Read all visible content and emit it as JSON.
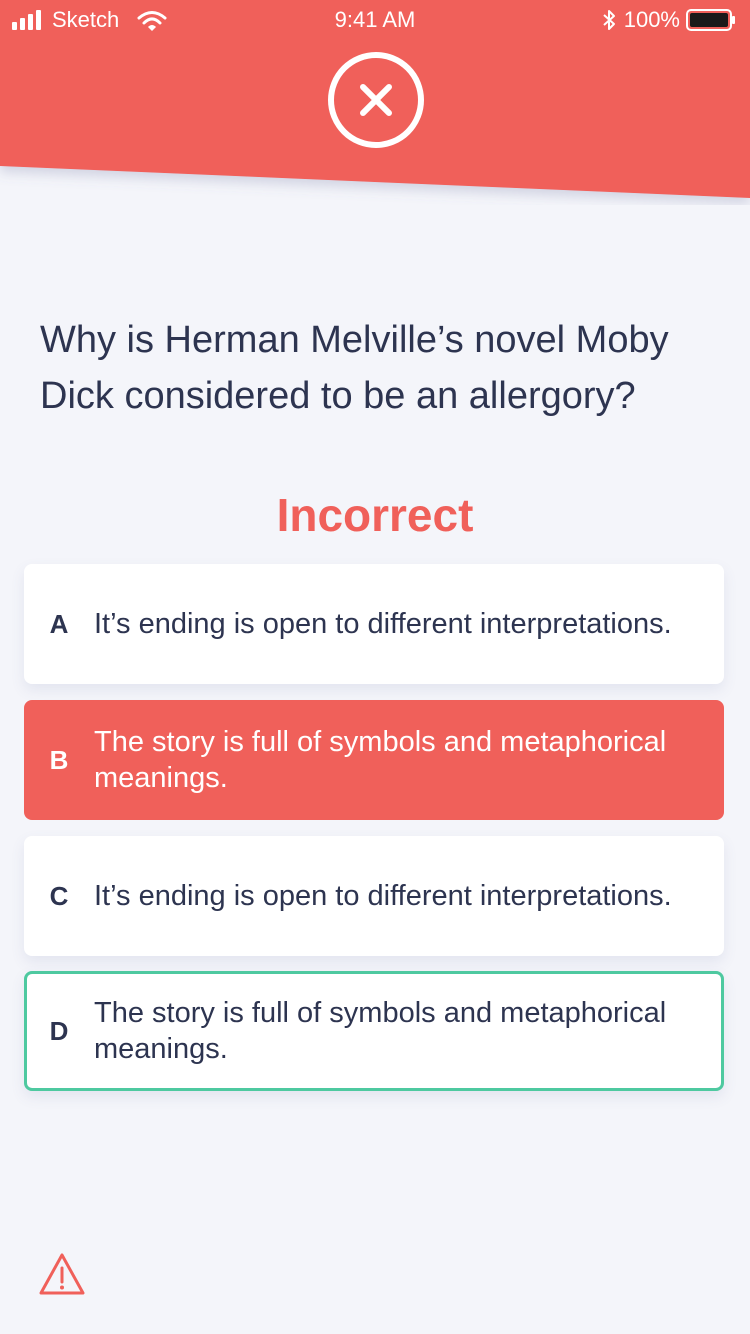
{
  "status_bar": {
    "carrier": "Sketch",
    "time": "9:41 AM",
    "battery": "100%"
  },
  "quiz": {
    "question": "Why is Herman Melville’s novel Moby Dick considered to be an allergory?",
    "result": "Incorrect",
    "options": [
      {
        "letter": "A",
        "text": "It’s ending is open to different interpretations.",
        "state": "default"
      },
      {
        "letter": "B",
        "text": "The story is full of symbols and metaphorical meanings.",
        "state": "selected-incorrect"
      },
      {
        "letter": "C",
        "text": "It’s ending is open to different interpretations.",
        "state": "default"
      },
      {
        "letter": "D",
        "text": "The story is full of symbols and metaphorical meanings.",
        "state": "correct-answer"
      }
    ]
  },
  "icons": {
    "header": "close-circle-icon",
    "footer": "warning-triangle-icon"
  },
  "colors": {
    "header": "#f0605a",
    "background": "#f4f5fa",
    "incorrect": "#f0605a",
    "correct_border": "#4ec9a0",
    "text": "#2d3450"
  }
}
